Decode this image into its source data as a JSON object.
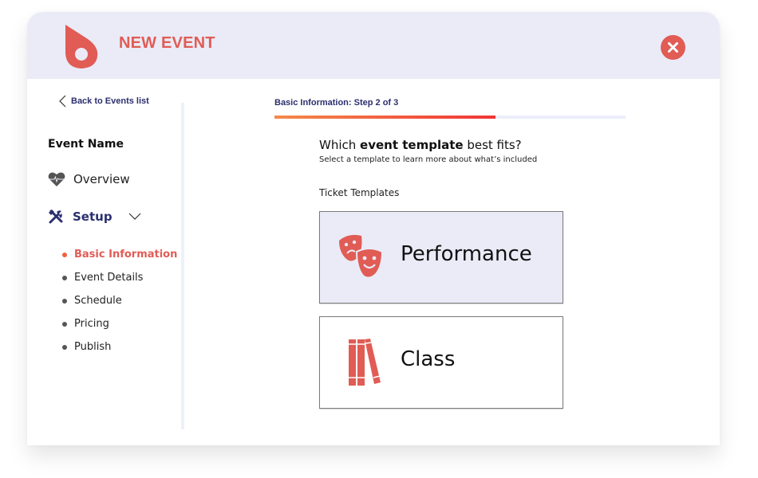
{
  "header": {
    "title": "NEW EVENT",
    "logo_icon": "droplet-logo-icon",
    "close_icon": "close-icon"
  },
  "colors": {
    "brand": "#e05c55",
    "navy": "#2c2f6e",
    "header_bg": "#eaebf7",
    "progress_start": "#f48a4a",
    "progress_end": "#f03636"
  },
  "sidebar": {
    "back_label": "Back to Events list",
    "event_name": "Event Name",
    "overview": {
      "label": "Overview",
      "icon": "heart-pulse-icon"
    },
    "setup": {
      "label": "Setup",
      "icon": "tools-icon",
      "expanded": true
    },
    "sub_items": [
      {
        "label": "Basic Information",
        "active": true
      },
      {
        "label": "Event Details",
        "active": false
      },
      {
        "label": "Schedule",
        "active": false
      },
      {
        "label": "Pricing",
        "active": false
      },
      {
        "label": "Publish",
        "active": false
      }
    ]
  },
  "main": {
    "step_label": "Basic Information: Step 2 of 3",
    "progress": 0.63,
    "question_prefix": "Which ",
    "question_bold": "event template",
    "question_suffix": " best fits?",
    "question_sub": "Select a template to learn more about what’s included",
    "section_label": "Ticket Templates",
    "templates": [
      {
        "name": "Performance",
        "icon": "theater-masks-icon",
        "selected": true
      },
      {
        "name": "Class",
        "icon": "books-icon",
        "selected": false
      }
    ]
  }
}
